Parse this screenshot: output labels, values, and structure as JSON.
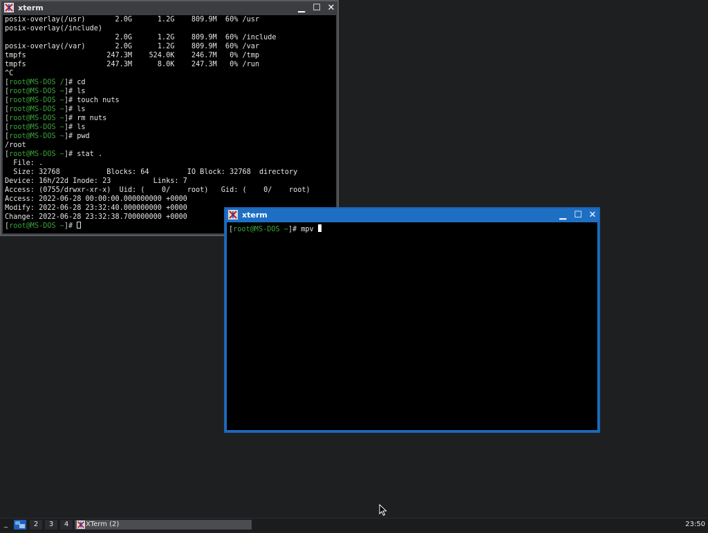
{
  "windows": {
    "back": {
      "title": "xterm",
      "lines": [
        "posix-overlay(/usr)       2.0G      1.2G    809.9M  60% /usr",
        "posix-overlay(/include)",
        "                          2.0G      1.2G    809.9M  60% /include",
        "posix-overlay(/var)       2.0G      1.2G    809.9M  60% /var",
        "tmpfs                   247.3M    524.0K    246.7M   0% /tmp",
        "tmpfs                   247.3M      8.0K    247.3M   0% /run",
        "^C",
        {
          "prompt": "[root@MS-DOS /]# ",
          "cmd": "cd"
        },
        {
          "prompt": "[root@MS-DOS ~]# ",
          "cmd": "ls"
        },
        {
          "prompt": "[root@MS-DOS ~]# ",
          "cmd": "touch nuts"
        },
        {
          "prompt": "[root@MS-DOS ~]# ",
          "cmd": "ls"
        },
        {
          "prompt": "[root@MS-DOS ~]# ",
          "cmd": "rm nuts"
        },
        {
          "prompt": "[root@MS-DOS ~]# ",
          "cmd": "ls"
        },
        {
          "prompt": "[root@MS-DOS ~]# ",
          "cmd": "pwd"
        },
        "/root",
        {
          "prompt": "[root@MS-DOS ~]# ",
          "cmd": "stat ."
        },
        "  File: .",
        "  Size: 32768           Blocks: 64         IO Block: 32768  directory",
        "Device: 16h/22d Inode: 23          Links: 7",
        "Access: (0755/drwxr-xr-x)  Uid: (    0/    root)   Gid: (    0/    root)",
        "Access: 2022-06-28 00:00:00.000000000 +0000",
        "Modify: 2022-06-28 23:32:40.000000000 +0000",
        "Change: 2022-06-28 23:32:38.700000000 +0000",
        {
          "prompt": "[root@MS-DOS ~]# ",
          "cmd": "",
          "cursor": "box"
        }
      ]
    },
    "front": {
      "title": "xterm",
      "lines": [
        {
          "prompt": "[root@MS-DOS ~]# ",
          "cmd": "mpv ",
          "cursor": "solid"
        }
      ]
    }
  },
  "taskbar": {
    "workspaces": [
      "1",
      "2",
      "3",
      "4"
    ],
    "active_workspace": "1",
    "task_label": "XTerm (2)",
    "clock": "23:50"
  },
  "colors": {
    "desktop": "#1e1f21",
    "active_border": "#1e6fc4",
    "inactive_border": "#3b3d40",
    "prompt_host": "#3aa43a"
  }
}
